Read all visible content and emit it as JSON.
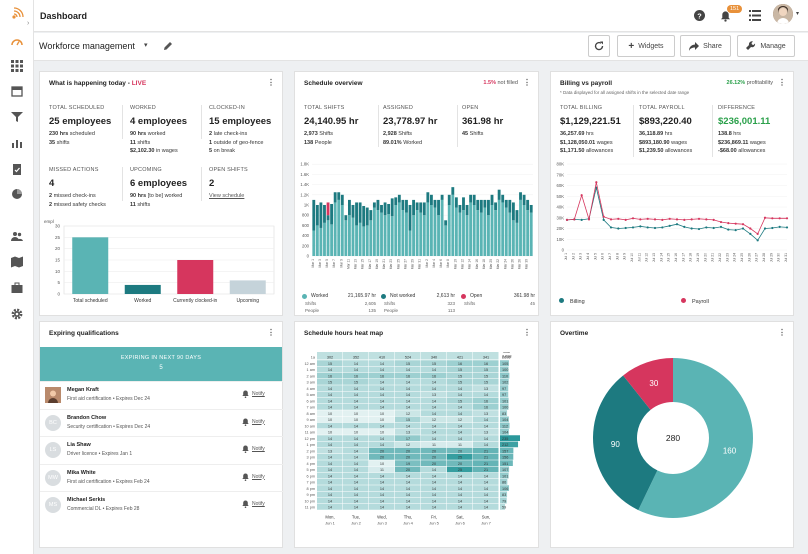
{
  "app": {
    "title": "Dashboard",
    "notification_count": "151"
  },
  "toolbar": {
    "context": "Workforce management",
    "widgets": "Widgets",
    "share": "Share",
    "manage": "Manage"
  },
  "happening": {
    "title": "What is happening today -",
    "live": "LIVE",
    "stats": [
      {
        "label": "TOTAL SCHEDULED",
        "value": "25 employees",
        "l1b": "230 hrs",
        "l1": "scheduled",
        "l2b": "35",
        "l2": "shifts",
        "l3b": "",
        "l3": ""
      },
      {
        "label": "WORKED",
        "value": "4 employees",
        "l1b": "90 hrs",
        "l1": "worked",
        "l2b": "11",
        "l2": "shifts",
        "l3b": "$2,102.30",
        "l3": "in wages"
      },
      {
        "label": "CLOCKED-IN",
        "value": "15 employees",
        "l1b": "2",
        "l1": "late check-ins",
        "l2b": "1",
        "l2": "outside of geo-fence",
        "l3b": "5",
        "l3": "on break"
      },
      {
        "label": "MISSED ACTIONS",
        "value": "4",
        "l1b": "2",
        "l1": "missed check-ins",
        "l2b": "2",
        "l2": "missed safety checks",
        "l3b": "",
        "l3": ""
      },
      {
        "label": "UPCOMING",
        "value": "6 employees",
        "l1b": "90 hrs",
        "l1": "[to be] worked",
        "l2b": "11",
        "l2": "shifts",
        "l3b": "",
        "l3": ""
      },
      {
        "label": "OPEN SHIFTS",
        "value": "2",
        "l1b": "",
        "l1": "",
        "l2b": "",
        "l2": "",
        "l3b": "",
        "l3": "",
        "link": "View schedule"
      }
    ]
  },
  "schedule": {
    "title": "Schedule overview",
    "not_filled_pct": "1.5%",
    "not_filled_label": "not filled",
    "stats": [
      {
        "label": "TOTAL SHIFTS",
        "value": "24,140.95 hr",
        "l1b": "2,973",
        "l1": "Shifts",
        "l2b": "138",
        "l2": "People"
      },
      {
        "label": "ASSIGNED",
        "value": "23,778.97 hr",
        "l1b": "2,928",
        "l1": "Shifts",
        "l2b": "89.01%",
        "l2": "Worked"
      },
      {
        "label": "OPEN",
        "value": "361.98 hr",
        "l1b": "45",
        "l1": "Shifts",
        "l2b": "",
        "l2": ""
      }
    ],
    "legend": [
      {
        "name": "Worked",
        "value": "21,165.97 hr",
        "shifts_label": "Shifts",
        "shifts": "2,605",
        "people_label": "People",
        "people": "135",
        "color": "#5ab4b4"
      },
      {
        "name": "Not worked",
        "value": "2,613 hr",
        "shifts_label": "Shifts",
        "shifts": "323",
        "people_label": "People",
        "people": "113",
        "color": "#1d7a80"
      },
      {
        "name": "Open",
        "value": "361.98 hr",
        "shifts_label": "Shifts",
        "shifts": "45",
        "people_label": "",
        "people": "",
        "color": "#d6365e"
      }
    ]
  },
  "billing": {
    "title": "Billing vs payroll",
    "profit_pct": "26.12%",
    "profit_label": "profitability",
    "note": "* Data displayed for all assigned shifts in the selected date range",
    "stats": [
      {
        "label": "TOTAL BILLING",
        "value": "$1,129,221.51",
        "lines": [
          [
            "36,257.69",
            "hrs"
          ],
          [
            "$1,128,050.01",
            "wages"
          ],
          [
            "$1,171.50",
            "allowances"
          ]
        ]
      },
      {
        "label": "TOTAL PAYROLL",
        "value": "$893,220.40",
        "lines": [
          [
            "36,118.89",
            "hrs"
          ],
          [
            "$893,180.90",
            "wages"
          ],
          [
            "$1,239.50",
            "allowances"
          ]
        ]
      },
      {
        "label": "DIFFERENCE",
        "value": "$236,001.11",
        "lines": [
          [
            "138.8",
            "hrs"
          ],
          [
            "$236,869.11",
            "wages"
          ],
          [
            "-$68.00",
            "allowances"
          ]
        ]
      }
    ],
    "legend": [
      {
        "name": "Billing",
        "color": "#1d7a80"
      },
      {
        "name": "Payroll",
        "color": "#d6365e"
      }
    ]
  },
  "qualifications": {
    "title": "Expiring qualifications",
    "banner_label": "EXPIRING IN NEXT 90 DAYS",
    "banner_count": "5",
    "notify_label": "Notify",
    "items": [
      {
        "initials": "",
        "name": "Megan Kraft",
        "detail": "First aid certification • Expires Dec 24"
      },
      {
        "initials": "BC",
        "name": "Brandon Chow",
        "detail": "Security certification • Expires Dec 24"
      },
      {
        "initials": "LS",
        "name": "Lia Shaw",
        "detail": "Driver licence • Expires Jan 1"
      },
      {
        "initials": "MW",
        "name": "Mika White",
        "detail": "First aid certification • Expires Feb 24"
      },
      {
        "initials": "MS",
        "name": "Michael Serkis",
        "detail": "Commercial DL • Expires Feb 28"
      }
    ]
  },
  "heatmap": {
    "title": "Schedule hours heat map",
    "total_label": "Total",
    "total_value": "2,698"
  },
  "overtime": {
    "title": "Overtime"
  },
  "chart_data": [
    {
      "type": "bar",
      "title": "",
      "ylabel": "empl",
      "ylim": [
        0,
        30
      ],
      "yticks": [
        0,
        5,
        10,
        15,
        20,
        25,
        30
      ],
      "categories": [
        "Total scheduled",
        "Worked",
        "Currently clocked-in",
        "Upcoming"
      ],
      "values": [
        25,
        4,
        15,
        6
      ],
      "colors": [
        "#5ab4b4",
        "#1d7a80",
        "#d6365e",
        "#c5d3da"
      ]
    },
    {
      "type": "bar",
      "stacked": true,
      "title": "",
      "ylim": [
        0,
        2000
      ],
      "yticks": [
        0,
        200,
        400,
        600,
        800,
        1000,
        1200,
        1400,
        1600,
        1800
      ],
      "ytick_labels": [
        "0",
        "200",
        "400",
        "600",
        "800",
        "1K",
        "1.2K",
        "1.4K",
        "1.6K",
        "1.8K"
      ],
      "categories": [
        "Mar 1",
        "Mar 2",
        "Mar 3",
        "Mar 4",
        "Mar 5",
        "Mar 6",
        "Mar 7",
        "Mar 8",
        "Mar 9",
        "Mar 10",
        "Mar 11",
        "Mar 12",
        "Mar 13",
        "Mar 14",
        "Mar 15",
        "Mar 16",
        "Mar 17",
        "Mar 18",
        "Mar 19",
        "Mar 20",
        "Mar 21",
        "Mar 22",
        "Mar 23",
        "Mar 24",
        "Mar 25",
        "Mar 26",
        "Mar 27",
        "Mar 28",
        "Mar 29",
        "Mar 30",
        "Mar 31",
        "Mar 1",
        "Mar 2",
        "Mar 3",
        "Mar 4",
        "Mar 5",
        "Mar 6",
        "Mar 7",
        "Mar 8",
        "Mar 9",
        "Mar 10",
        "Mar 11",
        "Mar 12",
        "Mar 13",
        "Mar 14",
        "Mar 15",
        "Mar 16",
        "Mar 17",
        "Mar 18",
        "Mar 19",
        "Mar 20",
        "Mar 21",
        "Mar 22",
        "Mar 23",
        "Mar 24",
        "Mar 25",
        "Mar 26",
        "Mar 27",
        "Mar 28",
        "Mar 29",
        "Mar 30",
        "Mar 31"
      ],
      "series": [
        {
          "name": "Worked",
          "color": "#5ab4b4",
          "values": [
            500,
            600,
            550,
            650,
            700,
            620,
            1050,
            1100,
            1000,
            700,
            800,
            750,
            600,
            650,
            580,
            600,
            700,
            950,
            900,
            850,
            800,
            820,
            780,
            1000,
            1050,
            900,
            850,
            500,
            800,
            900,
            850,
            800,
            1050,
            1000,
            950,
            800,
            1100,
            600,
            1000,
            1200,
            950,
            850,
            900,
            800,
            1050,
            1000,
            900,
            850,
            950,
            800,
            1000,
            900,
            1100,
            1050,
            950,
            850,
            700,
            650,
            1100,
            1000,
            900,
            850
          ]
        },
        {
          "name": "Not worked",
          "color": "#1d7a80",
          "values": [
            600,
            400,
            500,
            350,
            100,
            400,
            200,
            150,
            200,
            100,
            300,
            250,
            450,
            400,
            400,
            350,
            200,
            100,
            200,
            150,
            250,
            200,
            350,
            150,
            150,
            200,
            250,
            500,
            300,
            150,
            200,
            250,
            200,
            200,
            150,
            300,
            100,
            100,
            200,
            150,
            200,
            150,
            250,
            200,
            150,
            200,
            200,
            250,
            150,
            300,
            200,
            150,
            200,
            150,
            150,
            250,
            350,
            250,
            150,
            200,
            200,
            150
          ]
        },
        {
          "name": "Open",
          "color": "#d6365e",
          "values": [
            0,
            0,
            0,
            0,
            250,
            0,
            0,
            0,
            0,
            0,
            0,
            0,
            0,
            0,
            0,
            0,
            0,
            0,
            0,
            0,
            0,
            0,
            0,
            0,
            0,
            0,
            0,
            0,
            0,
            0,
            0,
            0,
            0,
            0,
            0,
            0,
            0,
            0,
            0,
            0,
            0,
            0,
            0,
            0,
            0,
            0,
            0,
            0,
            0,
            0,
            0,
            0,
            0,
            0,
            0,
            0,
            0,
            0,
            0,
            0,
            0,
            0
          ]
        }
      ]
    },
    {
      "type": "line",
      "title": "",
      "ylim": [
        0,
        80000
      ],
      "yticks": [
        0,
        10000,
        20000,
        30000,
        40000,
        50000,
        60000,
        70000,
        80000
      ],
      "ytick_labels": [
        "0",
        "10K",
        "20K",
        "30K",
        "40K",
        "50K",
        "60K",
        "70K",
        "80K"
      ],
      "x": [
        "Jul 1",
        "Jul 2",
        "Jul 3",
        "Jul 4",
        "Jul 5",
        "Jul 6",
        "Jul 7",
        "Jul 8",
        "Jul 9",
        "Jul 10",
        "Jul 11",
        "Jul 12",
        "Jul 13",
        "Jul 14",
        "Jul 15",
        "Jul 16",
        "Jul 17",
        "Jul 18",
        "Jul 19",
        "Jul 20",
        "Jul 21",
        "Jul 22",
        "Jul 23",
        "Jul 24",
        "Jul 25",
        "Jul 26",
        "Jul 27",
        "Jul 28",
        "Jul 29",
        "Jul 30",
        "Jul 31"
      ],
      "series": [
        {
          "name": "Billing",
          "color": "#1d7a80",
          "values": [
            28000,
            28500,
            28000,
            29000,
            58000,
            28000,
            21000,
            20000,
            20500,
            21000,
            22000,
            21000,
            20500,
            21000,
            22500,
            24000,
            21500,
            20000,
            19500,
            21000,
            20500,
            21500,
            19000,
            18500,
            20000,
            15000,
            9000,
            20000,
            20500,
            21500,
            21000
          ]
        },
        {
          "name": "Payroll",
          "color": "#d6365e",
          "values": [
            28000,
            28500,
            51000,
            28500,
            63000,
            31000,
            28500,
            29000,
            28000,
            29500,
            28500,
            29000,
            28500,
            28000,
            29000,
            28500,
            28000,
            28500,
            29000,
            28500,
            28000,
            26000,
            25000,
            24500,
            24000,
            20000,
            15000,
            30000,
            29500,
            29500,
            29500
          ]
        }
      ]
    },
    {
      "type": "heatmap",
      "title": "",
      "x": [
        "Mon, Jun 1",
        "Tue, Jun 2",
        "Wed, Jun 3",
        "Thu, Jun 4",
        "Fri, Jun 5",
        "Sat, Jun 6",
        "Sun, Jun 7"
      ],
      "y": [
        "1a",
        "12 am",
        "1 am",
        "2 am",
        "3 am",
        "4 am",
        "5 am",
        "6 am",
        "7 am",
        "8 am",
        "9 am",
        "10 am",
        "11 am",
        "12 pm",
        "1 pm",
        "2 pm",
        "3 pm",
        "4 pm",
        "5 pm",
        "6 pm",
        "7 pm",
        "8 pm",
        "9 pm",
        "10 pm",
        "11 pm"
      ],
      "col_totals": [
        302,
        352,
        410,
        524,
        340,
        421,
        341
      ],
      "row_totals": [
        2698,
        105,
        100,
        110,
        102,
        97,
        97,
        101,
        100,
        83,
        104,
        112,
        104,
        235,
        212,
        157,
        156,
        151,
        107,
        101,
        86,
        106,
        83,
        79,
        59
      ],
      "values": [
        [
          302,
          352,
          410,
          524,
          340,
          421,
          341
        ],
        [
          15,
          14,
          14,
          15,
          15,
          16,
          16
        ],
        [
          14,
          14,
          14,
          14,
          14,
          15,
          15
        ],
        [
          16,
          16,
          16,
          16,
          16,
          15,
          15
        ],
        [
          15,
          15,
          14,
          14,
          14,
          15,
          15
        ],
        [
          14,
          14,
          14,
          14,
          14,
          14,
          13
        ],
        [
          14,
          14,
          14,
          14,
          13,
          14,
          14
        ],
        [
          14,
          14,
          14,
          14,
          14,
          15,
          16
        ],
        [
          14,
          14,
          14,
          14,
          14,
          14,
          16
        ],
        [
          10,
          10,
          10,
          12,
          14,
          14,
          13
        ],
        [
          10,
          10,
          10,
          15,
          12,
          12,
          14
        ],
        [
          14,
          14,
          14,
          14,
          14,
          14,
          14
        ],
        [
          10,
          10,
          10,
          13,
          14,
          14,
          13
        ],
        [
          14,
          14,
          14,
          17,
          14,
          14,
          14
        ],
        [
          14,
          14,
          14,
          12,
          11,
          11,
          14
        ],
        [
          13,
          14,
          20,
          20,
          20,
          20,
          21
        ],
        [
          14,
          14,
          20,
          20,
          20,
          25,
          21
        ],
        [
          14,
          14,
          10,
          19,
          20,
          20,
          21
        ],
        [
          14,
          14,
          11,
          20,
          14,
          25,
          21
        ],
        [
          14,
          14,
          14,
          14,
          14,
          14,
          14
        ],
        [
          14,
          14,
          14,
          14,
          14,
          14,
          14
        ],
        [
          14,
          14,
          14,
          14,
          14,
          14,
          14
        ],
        [
          14,
          14,
          14,
          14,
          14,
          14,
          14
        ],
        [
          14,
          14,
          14,
          14,
          14,
          14,
          14
        ],
        [
          14,
          14,
          14,
          14,
          14,
          14,
          14
        ]
      ]
    },
    {
      "type": "pie",
      "donut": true,
      "title": "",
      "center_label": "280",
      "slices": [
        {
          "label": "160",
          "value": 160,
          "color": "#5ab4b4"
        },
        {
          "label": "90",
          "value": 90,
          "color": "#1d7a80"
        },
        {
          "label": "30",
          "value": 30,
          "color": "#d6365e"
        }
      ]
    }
  ]
}
